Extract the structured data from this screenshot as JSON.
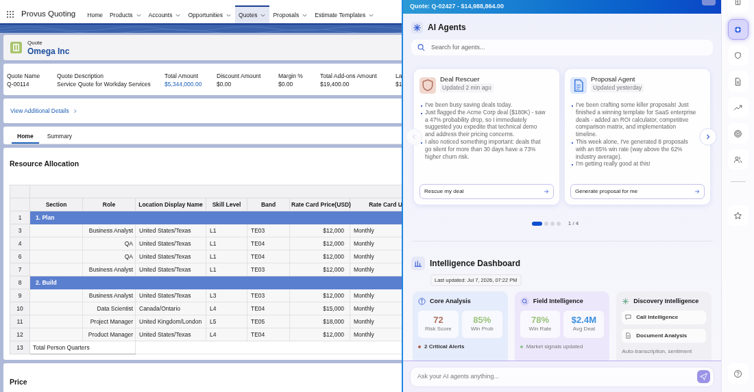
{
  "app": {
    "name": "Provus Quoting"
  },
  "nav": [
    {
      "label": "Home",
      "dropdown": false,
      "selected": false
    },
    {
      "label": "Products",
      "dropdown": true,
      "selected": false
    },
    {
      "label": "Accounts",
      "dropdown": true,
      "selected": false
    },
    {
      "label": "Opportunities",
      "dropdown": true,
      "selected": false
    },
    {
      "label": "Quotes",
      "dropdown": true,
      "selected": true
    },
    {
      "label": "Proposals",
      "dropdown": true,
      "selected": false
    },
    {
      "label": "Estimate Templates",
      "dropdown": true,
      "selected": false
    }
  ],
  "record": {
    "type": "Quote",
    "name": "Omega Inc"
  },
  "fields": [
    {
      "label": "Quote Name",
      "value": "Q-00114",
      "kind": "text"
    },
    {
      "label": "Quote Description",
      "value": "Service Quote for Workday Services",
      "kind": "text"
    },
    {
      "label": "Total Amount",
      "value": "$5,344,000.00",
      "kind": "link"
    },
    {
      "label": "Discount Amount",
      "value": "$0.00",
      "kind": "text"
    },
    {
      "label": "Margin %",
      "value": "$0.00",
      "kind": "text"
    },
    {
      "label": "Total Add-ons Amount",
      "value": "$19,400.00",
      "kind": "text"
    },
    {
      "label": "La",
      "value": "$1",
      "kind": "text"
    }
  ],
  "details_link": "View Additional Details",
  "tabs": [
    {
      "label": "Home",
      "selected": true
    },
    {
      "label": "Summary",
      "selected": false
    }
  ],
  "resource_allocation": {
    "title": "Resource Allocation",
    "columns": [
      "Section",
      "Role",
      "Location Display Name",
      "Skill Level",
      "Band",
      "Rate Card Price(USD)",
      "Rate Card U"
    ],
    "rows": [
      {
        "number": "1",
        "kind": "section",
        "label": "1. Plan"
      },
      {
        "number": "3",
        "kind": "item",
        "role": "Business Analyst",
        "location": "United States/Texas",
        "skill": "L1",
        "band": "TE03",
        "price": "$12,000",
        "unit": "Monthly"
      },
      {
        "number": "4",
        "kind": "item",
        "role": "QA",
        "location": "United States/Texas",
        "skill": "L1",
        "band": "TE04",
        "price": "$12,000",
        "unit": "Monthly"
      },
      {
        "number": "6",
        "kind": "item",
        "role": "QA",
        "location": "United States/Texas",
        "skill": "L1",
        "band": "TE04",
        "price": "$12,000",
        "unit": "Monthly"
      },
      {
        "number": "7",
        "kind": "item",
        "role": "Business Analyst",
        "location": "United States/Texas",
        "skill": "L1",
        "band": "TE03",
        "price": "$12,000",
        "unit": "Monthly"
      },
      {
        "number": "8",
        "kind": "section",
        "label": "2. Build"
      },
      {
        "number": "9",
        "kind": "item",
        "role": "Business Analyst",
        "location": "United States/Texas",
        "skill": "L3",
        "band": "TE03",
        "price": "$12,000",
        "unit": "Monthly"
      },
      {
        "number": "10",
        "kind": "item",
        "role": "Data Scientist",
        "location": "Canada/Ontario",
        "skill": "L4",
        "band": "TE04",
        "price": "$15,000",
        "unit": "Monthly"
      },
      {
        "number": "11",
        "kind": "item",
        "role": "Project Manager",
        "location": "United Kingdom/London",
        "skill": "L5",
        "band": "TE05",
        "price": "$18,000",
        "unit": "Monthly"
      },
      {
        "number": "12",
        "kind": "item",
        "role": "Product Manager",
        "location": "United States/Texas",
        "skill": "L4",
        "band": "TE04",
        "price": "$12,000",
        "unit": "Monthly"
      },
      {
        "number": "13",
        "kind": "total",
        "label": "Total Person Quarters"
      }
    ]
  },
  "price": {
    "title": "Price"
  },
  "ai_panel": {
    "banner": "Quote: Q-02427 - $14,988,864.00",
    "agents": {
      "title": "AI Agents",
      "search_placeholder": "Search for agents...",
      "cards": [
        {
          "kind": "rescuer",
          "name": "Deal Rescuer",
          "updated": "Updated 2 min ago",
          "bullets": [
            "I've been busy saving deals today.",
            "Just flagged the Acme Corp deal ($180K) - saw a 47% probability drop, so I immediately suggested you expedite that technical demo and address their pricing concerns.",
            "I also noticed something important: deals that go silent for more than 30 days have a 73% higher churn risk."
          ],
          "action": "Rescue my deal"
        },
        {
          "kind": "proposal",
          "name": "Proposal Agent",
          "updated": "Updated yesterday",
          "bullets": [
            "I've been crafting some killer proposals! Just finished a winning template for SaaS enterprise deals - added an ROI calculator, competitive comparison matrix, and implementation timeline.",
            "This week alone, I've generated 8 proposals with an 85% win rate (way above the 62% industry average).",
            "I'm getting really good at this!"
          ],
          "action": "Generate proposal for me"
        }
      ],
      "pages": [
        {
          "selected": true
        },
        {
          "selected": false
        },
        {
          "selected": false
        },
        {
          "selected": false
        }
      ],
      "page_label": "1 / 4"
    },
    "dashboard": {
      "title": "Intelligence Dashboard",
      "last_updated": "Last updated: Jul 7, 2026, 07:22 PM",
      "cards": [
        {
          "kind": "metrics",
          "title": "Core Analysis",
          "metrics": [
            {
              "value": "72",
              "label": "Risk Score",
              "color": "#b0705f"
            },
            {
              "value": "85%",
              "label": "Win Prob",
              "color": "#9cc47d"
            }
          ],
          "items": [
            {
              "text": "2 Critical Alerts",
              "color": "#b05a4a"
            }
          ]
        },
        {
          "kind": "metrics",
          "title": "Field Intelligence",
          "metrics": [
            {
              "value": "78%",
              "label": "Win Rate",
              "color": "#9cc47d"
            },
            {
              "value": "$2.4M",
              "label": "Avg Deal",
              "color": "#3b8fe0"
            }
          ],
          "items": [
            {
              "text": "Market signals updated",
              "color": "#8cc08a"
            }
          ]
        },
        {
          "kind": "links",
          "title": "Discovery Intelligence",
          "links": [
            "Call Intelligence",
            "Document Analysis"
          ],
          "note": "Auto-transcription, sentiment"
        }
      ]
    },
    "chat_placeholder": "Ask your AI agents anything..."
  },
  "rail": [
    {
      "selected": false
    },
    {
      "selected": true
    },
    {
      "selected": false
    },
    {
      "selected": false
    },
    {
      "selected": false
    },
    {
      "selected": false
    },
    {
      "selected": false
    },
    {
      "selected": false
    },
    {
      "selected": false
    }
  ]
}
